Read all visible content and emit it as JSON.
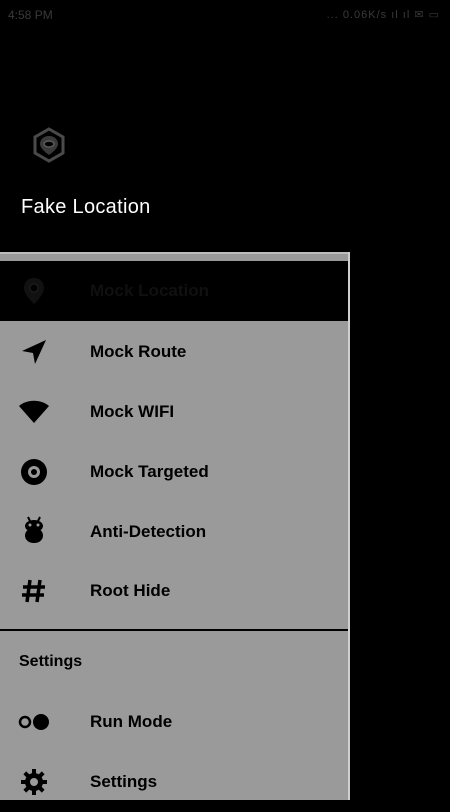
{
  "status_bar": {
    "time": "4:58 PM",
    "icons": "... 0.06K/s  ıl  ıl  ✉  ▭"
  },
  "drawer": {
    "app_title": "Fake Location",
    "logo_icon": "hexagon-location-icon"
  },
  "menu": {
    "items": [
      {
        "label": "Mock Location",
        "icon": "location-pin-icon",
        "active": true
      },
      {
        "label": "Mock Route",
        "icon": "navigation-arrow-icon",
        "active": false
      },
      {
        "label": "Mock WIFI",
        "icon": "wifi-icon",
        "active": false
      },
      {
        "label": "Mock Targeted",
        "icon": "target-icon",
        "active": false
      },
      {
        "label": "Anti-Detection",
        "icon": "android-icon",
        "active": false
      },
      {
        "label": "Root Hide",
        "icon": "hash-icon",
        "active": false
      }
    ],
    "settings_section": {
      "header": "Settings",
      "items": [
        {
          "label": "Run Mode",
          "icon": "run-mode-icon"
        },
        {
          "label": "Settings",
          "icon": "gear-icon"
        }
      ]
    }
  },
  "colors": {
    "drawer_bg": "#000000",
    "menu_bg": "#9a9a9a",
    "active_bg": "#000000",
    "text": "#000000",
    "title": "#ffffff"
  }
}
